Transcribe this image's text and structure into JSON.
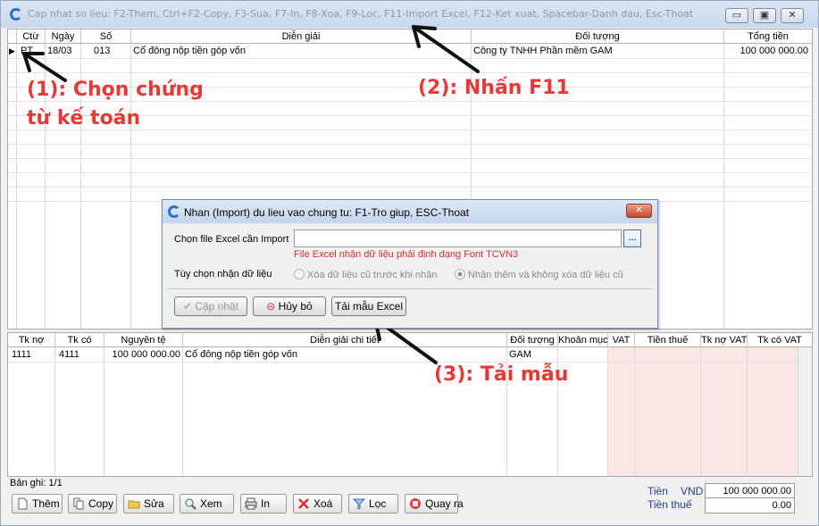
{
  "window": {
    "title": "Cap nhat so lieu: F2-Them, Ctrl+F2-Copy, F3-Sua, F7-In, F8-Xoa, F9-Loc, F11-Import Excel, F12-Ket xuat, Spacebar-Danh dau, Esc-Thoat",
    "controls": {
      "minimize": "▭",
      "restore": "▣",
      "close": "✕"
    }
  },
  "top_grid": {
    "columns": [
      "Ctừ",
      "Ngày",
      "Số",
      "Diễn giải",
      "Đối tượng",
      "Tổng tiền"
    ],
    "rows": [
      {
        "ctu": "PT",
        "ngay": "18/03",
        "so": "013",
        "dien_giai": "Cổ đông nộp tiền góp vốn",
        "doi_tuong": "Công ty TNHH Phần mềm GAM",
        "tong_tien": "100 000 000.00"
      }
    ]
  },
  "annotations": {
    "step1_line1": "(1): Chọn chứng",
    "step1_line2": "từ kế toán",
    "step2": "(2): Nhấn F11",
    "step3": "(3): Tải mẫu"
  },
  "dialog": {
    "title": "Nhan (Import) du lieu vao chung tu: F1-Tro giup, ESC-Thoat",
    "file_label": "Chọn file Excel cần Import",
    "file_value": "",
    "browse_label": "...",
    "note": "File Excel nhận dữ liệu phải định dạng Font TCVN3",
    "options_label": "Tùy chọn nhận dữ liệu",
    "option1": "Xóa dữ liệu cũ trước khi nhận",
    "option2": "Nhận thêm và không xóa dữ liệu cũ",
    "btn_update": "Cập nhật",
    "btn_cancel": "Hủy bỏ",
    "btn_template": "Tải mẫu Excel",
    "close": "✕"
  },
  "detail_grid": {
    "columns": [
      "Tk nợ",
      "Tk có",
      "Nguyên tệ",
      "Diễn giải chi tiết",
      "Đối tượng",
      "Khoản mục",
      "VAT",
      "Tiền thuế",
      "Tk nợ VAT",
      "Tk có VAT"
    ],
    "rows": [
      {
        "tk_no": "1111",
        "tk_co": "4111",
        "nguyen_te": "100 000 000.00",
        "dien_giai": "Cổ đông nộp tiền góp vốn",
        "doi_tuong": "GAM",
        "khoan_muc": "",
        "vat": "",
        "tien_thue": "",
        "tk_no_vat": "",
        "tk_co_vat": ""
      }
    ]
  },
  "status": {
    "record_count": "Bản ghi: 1/1"
  },
  "toolbar": [
    "Thêm",
    "Copy",
    "Sửa",
    "Xem",
    "In",
    "Xoá",
    "Lọc",
    "Quay ra"
  ],
  "totals": {
    "tien_label": "Tiền",
    "currency": "VND",
    "tien_value": "100 000 000.00",
    "tien_thue_label": "Tiền thuế",
    "tien_thue_value": "0.00"
  },
  "colors": {
    "annotation": "#e53935",
    "vat_highlight": "#fbe6e6",
    "title_gradient": "#c9d8ec"
  }
}
